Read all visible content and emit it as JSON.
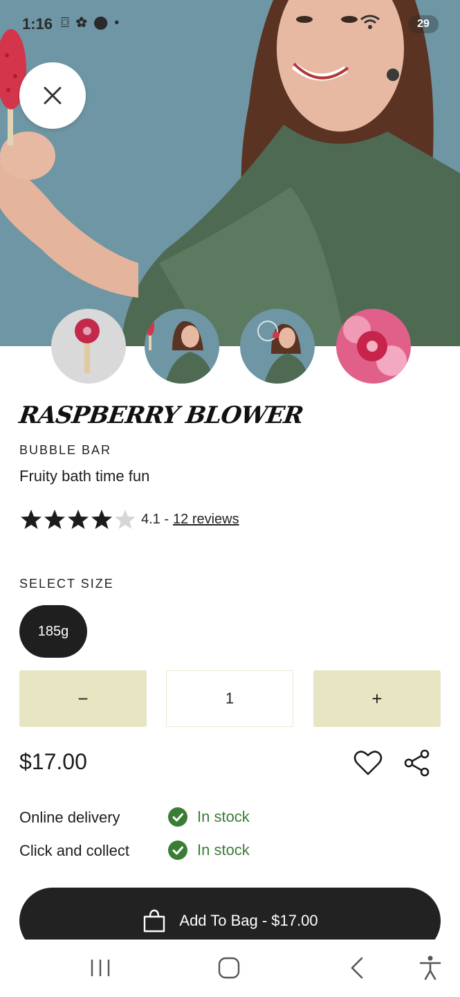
{
  "status_bar": {
    "time": "1:16",
    "icons": "⌼ ✿ ⬤ •",
    "battery": "29"
  },
  "hero": {
    "background": "#6f96a4",
    "close_icon": "close-icon"
  },
  "product": {
    "title": "RASPBERRY BLOWER",
    "category": "BUBBLE BAR",
    "tagline": "Fruity bath time fun",
    "rating_value": 4.1,
    "rating_text": "4.1 -",
    "reviews_link": "12 reviews"
  },
  "size": {
    "label": "SELECT SIZE",
    "selected": "185g"
  },
  "quantity": {
    "decrement": "−",
    "value": "1",
    "increment": "+"
  },
  "price": "$17.00",
  "availability": [
    {
      "label": "Online delivery",
      "status": "In stock"
    },
    {
      "label": "Click and collect",
      "status": "In stock"
    }
  ],
  "add_to_bag": "Add To Bag - $17.00",
  "colors": {
    "accent_quantity": "#e8e5c3",
    "in_stock": "#3a7d35",
    "button_dark": "#222222"
  }
}
